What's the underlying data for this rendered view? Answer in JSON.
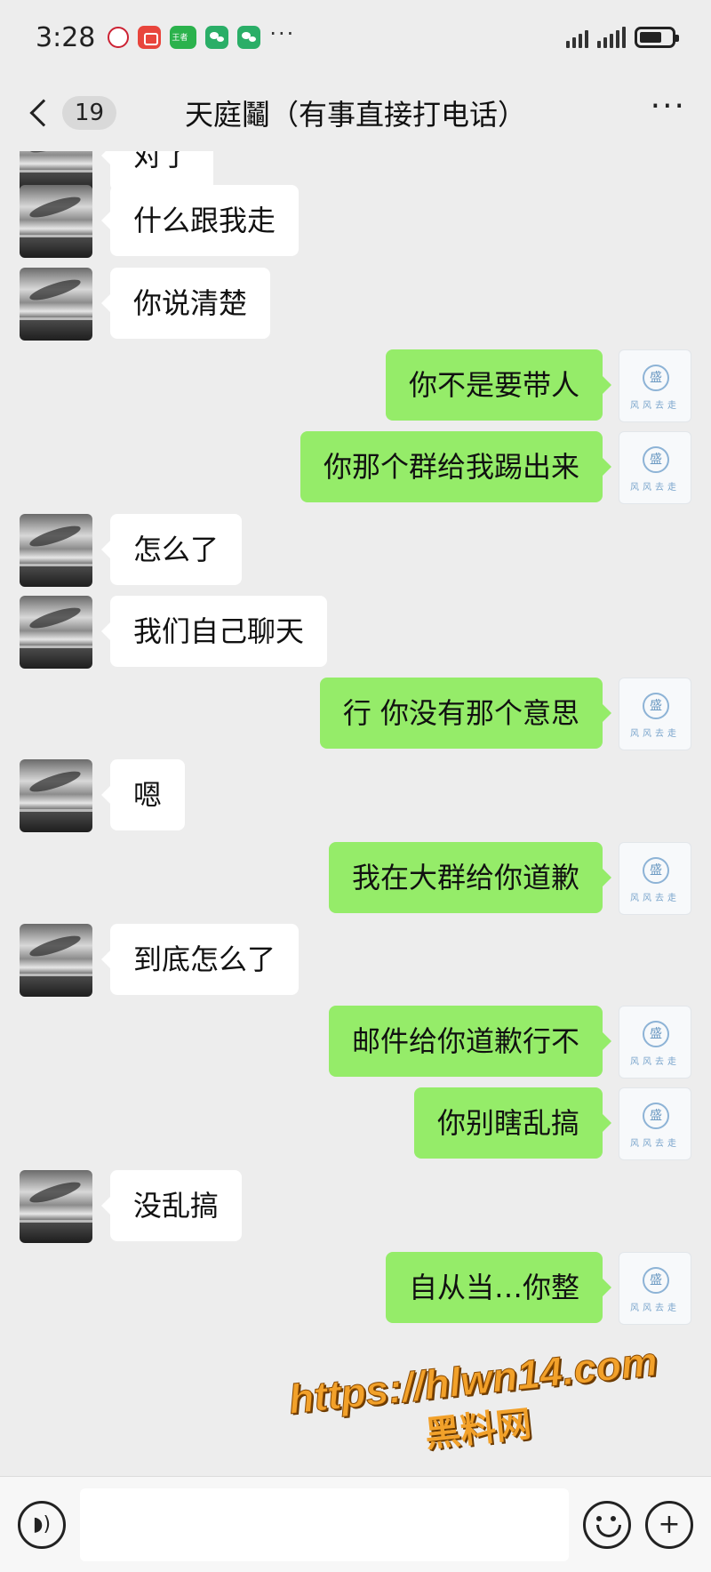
{
  "status_bar": {
    "time": "3:28",
    "dots": "···"
  },
  "header": {
    "unread_count": "19",
    "title": "天庭鬮（有事直接打电话）",
    "more": "···"
  },
  "messages": [
    {
      "side": "in",
      "text": "对了"
    },
    {
      "side": "in",
      "text": "什么跟我走"
    },
    {
      "side": "in",
      "text": "你说清楚"
    },
    {
      "side": "out",
      "text": "你不是要带人"
    },
    {
      "side": "out",
      "text": "你那个群给我踢出来"
    },
    {
      "side": "in",
      "text": "怎么了"
    },
    {
      "side": "in",
      "text": "我们自己聊天"
    },
    {
      "side": "out",
      "text": "行 你没有那个意思"
    },
    {
      "side": "in",
      "text": "嗯"
    },
    {
      "side": "out",
      "text": "我在大群给你道歉"
    },
    {
      "side": "in",
      "text": "到底怎么了"
    },
    {
      "side": "out",
      "text": "邮件给你道歉行不"
    },
    {
      "side": "out",
      "text": "你别瞎乱搞"
    },
    {
      "side": "in",
      "text": "没乱搞"
    },
    {
      "side": "out",
      "text": "自从当…你整"
    }
  ],
  "watermark": {
    "url": "https://hlwn14.com",
    "name": "黑料网"
  },
  "input_bar": {
    "placeholder": ""
  },
  "colors": {
    "background": "#ededed",
    "incoming_bubble": "#ffffff",
    "outgoing_bubble": "#95ec69",
    "watermark": "#f2a12a"
  },
  "icons": {
    "back": "chevron-left-icon",
    "more": "more-dots-icon",
    "voice": "voice-icon",
    "emoji": "emoji-icon",
    "add": "plus-icon"
  }
}
